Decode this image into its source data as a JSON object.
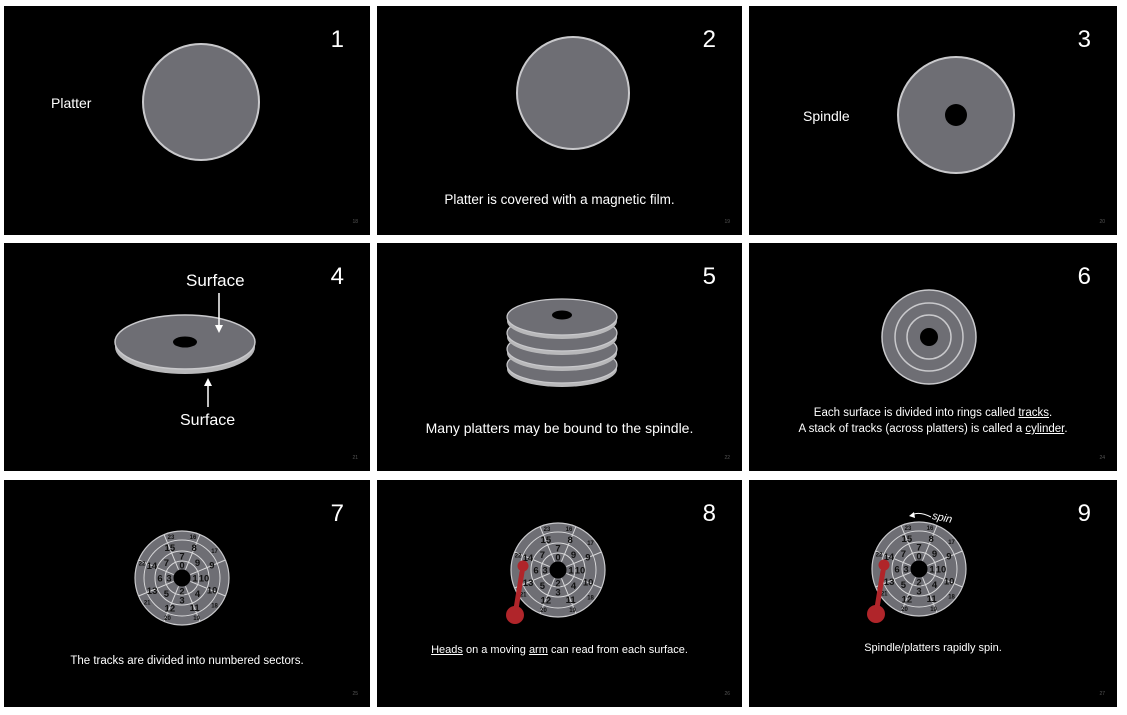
{
  "slides": [
    {
      "number": "1",
      "page": "18",
      "label": "Platter"
    },
    {
      "number": "2",
      "page": "19",
      "caption": "Platter is covered with a magnetic film."
    },
    {
      "number": "3",
      "page": "20",
      "label": "Spindle"
    },
    {
      "number": "4",
      "page": "21",
      "label_top": "Surface",
      "label_bottom": "Surface"
    },
    {
      "number": "5",
      "page": "22",
      "caption": "Many platters may be bound to the spindle."
    },
    {
      "number": "6",
      "page": "24",
      "caption_l1_a": "Each surface is divided into rings called ",
      "caption_l1_link": "tracks",
      "caption_l1_b": ".",
      "caption_l2_a": "A stack of tracks (across platters) is called a ",
      "caption_l2_link": "cylinder",
      "caption_l2_b": "."
    },
    {
      "number": "7",
      "page": "25",
      "caption": "The tracks are divided into numbered sectors."
    },
    {
      "number": "8",
      "page": "26",
      "caption_link1": "Heads",
      "caption_mid": " on a moving ",
      "caption_link2": "arm",
      "caption_end": " can read from each surface."
    },
    {
      "number": "9",
      "page": "27",
      "spin_label": "spin",
      "caption": "Spindle/platters rapidly spin."
    }
  ],
  "sectors": {
    "inner": [
      {
        "n": "0",
        "a": 0
      },
      {
        "n": "1",
        "a": 90
      },
      {
        "n": "2",
        "a": 180
      },
      {
        "n": "3",
        "a": 270
      }
    ],
    "middle": [
      {
        "n": "7",
        "a": 0
      },
      {
        "n": "9",
        "a": 45
      },
      {
        "n": "10",
        "a": 90
      },
      {
        "n": "4",
        "a": 135
      },
      {
        "n": "3",
        "a": 180
      },
      {
        "n": "5",
        "a": 225
      },
      {
        "n": "6",
        "a": 270
      },
      {
        "n": "7",
        "a": 315
      }
    ],
    "outer": [
      {
        "n": "15",
        "a": -22
      },
      {
        "n": "8",
        "a": 22
      },
      {
        "n": "9",
        "a": 67
      },
      {
        "n": "10",
        "a": 112
      },
      {
        "n": "11",
        "a": 157
      },
      {
        "n": "12",
        "a": 202
      },
      {
        "n": "13",
        "a": 247
      },
      {
        "n": "14",
        "a": 292
      }
    ],
    "rim": [
      {
        "n": "23",
        "a": -15
      },
      {
        "n": "16",
        "a": 15
      },
      {
        "n": "17",
        "a": 50
      },
      {
        "n": "18",
        "a": 130
      },
      {
        "n": "19",
        "a": 160
      },
      {
        "n": "20",
        "a": 200
      },
      {
        "n": "21",
        "a": 235
      },
      {
        "n": "22",
        "a": 290
      }
    ]
  },
  "colors": {
    "platter": "#6e6e74",
    "platter_edge": "#c9c9cc",
    "arm": "#b0252a",
    "background": "#000000"
  }
}
